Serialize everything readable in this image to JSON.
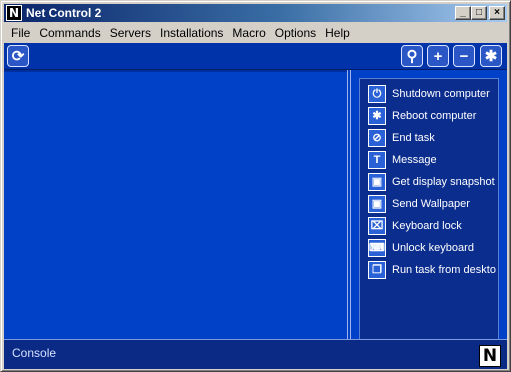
{
  "window": {
    "title": "Net Control 2",
    "app_icon_letter": "N",
    "controls": {
      "minimize": "_",
      "maximize": "□",
      "close": "×"
    }
  },
  "menu": {
    "items": [
      {
        "label": "File",
        "icon": null
      },
      {
        "label": "Commands",
        "icon": null
      },
      {
        "label": "Servers",
        "icon": null
      },
      {
        "label": "Installations",
        "icon": null
      },
      {
        "label": "Macro",
        "icon": null
      },
      {
        "label": "Options",
        "icon": null
      },
      {
        "label": "Help",
        "icon": null
      }
    ]
  },
  "toolbar": {
    "refresh_icon": "refresh-icon",
    "refresh_glyph": "⟳",
    "search_glyph": "⚲",
    "add_glyph": "+",
    "remove_glyph": "−",
    "asterisk_glyph": "✱"
  },
  "tasks": [
    {
      "label": "Shutdown computer",
      "icon": "power-icon",
      "glyph": "⏻"
    },
    {
      "label": "Reboot computer",
      "icon": "reboot-icon",
      "glyph": "✱"
    },
    {
      "label": "End task",
      "icon": "end-task-icon",
      "glyph": "⊘"
    },
    {
      "label": "Message",
      "icon": "message-icon",
      "glyph": "T"
    },
    {
      "label": "Get display snapshot",
      "icon": "snapshot-icon",
      "glyph": "▣"
    },
    {
      "label": "Send Wallpaper",
      "icon": "wallpaper-icon",
      "glyph": "▣"
    },
    {
      "label": "Keyboard lock",
      "icon": "keyboard-lock-icon",
      "glyph": "⌧"
    },
    {
      "label": "Unlock keyboard",
      "icon": "keyboard-unlock-icon",
      "glyph": "⌨"
    },
    {
      "label": "Run task from deskto",
      "icon": "run-task-icon",
      "glyph": "❐"
    }
  ],
  "console": {
    "label": "Console",
    "logo_letter": "N"
  },
  "colors": {
    "panel_blue": "#0041c8",
    "task_panel": "#0b2d8e",
    "toolbar": "#0033aa"
  }
}
